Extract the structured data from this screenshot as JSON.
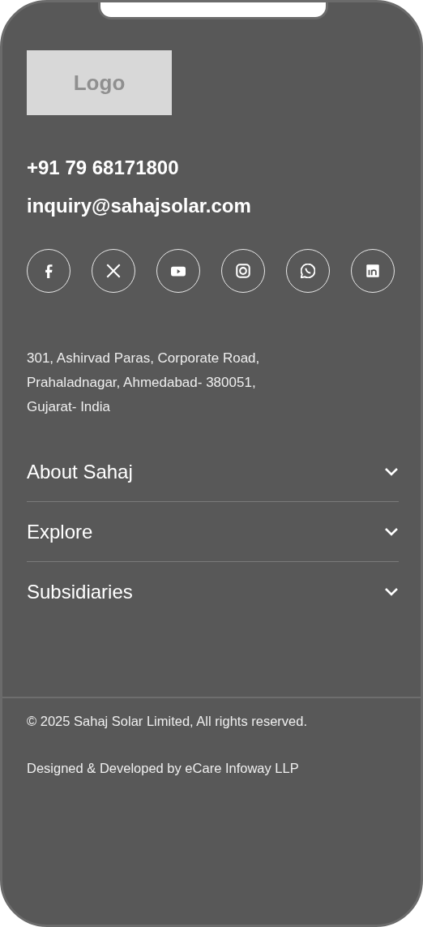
{
  "logo": {
    "label": "Logo"
  },
  "contact": {
    "phone": "+91 79 68171800",
    "email": "inquiry@sahajsolar.com"
  },
  "address": "301, Ashirvad Paras, Corporate Road, Prahaladnagar, Ahmedabad- 380051, Gujarat- India",
  "sections": [
    {
      "label": "About Sahaj",
      "expanded": false
    },
    {
      "label": "Explore",
      "expanded": false
    },
    {
      "label": "Subsidiaries",
      "expanded": false
    }
  ],
  "copyright": "© 2025 Sahaj Solar Limited, All rights reserved.",
  "credit": "Designed & Developed by eCare Infoway LLP"
}
